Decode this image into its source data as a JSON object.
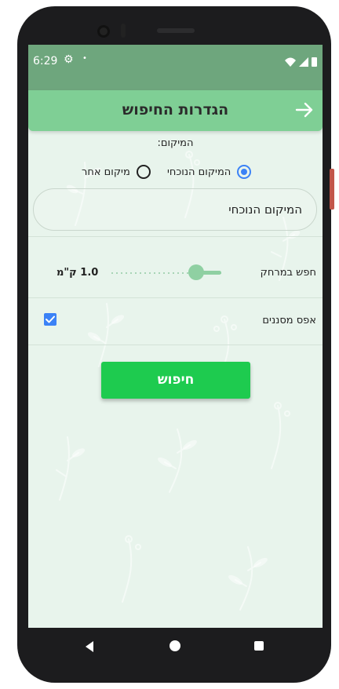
{
  "statusbar": {
    "time": "6:29",
    "dot": "•"
  },
  "appbar": {
    "title": "הגדרות החיפוש"
  },
  "form": {
    "location_label": "המיקום:",
    "radio_current_label": "המיקום הנוכחי",
    "radio_other_label": "מיקום אחר",
    "selected_radio": "current",
    "location_input_value": "המיקום הנוכחי",
    "distance_label": "חפש במרחק",
    "distance_value": "1.0 ק\"מ",
    "distance_fraction": 0.77,
    "reset_filters_label": "אפס מסננים",
    "reset_filters_checked": true,
    "search_button_label": "חיפוש"
  },
  "colors": {
    "statusbar": "#6ea67d",
    "appbar": "#7fcf95",
    "background": "#e8f4ec",
    "accent": "#3b82f6",
    "button": "#1ecb4f"
  },
  "icons": {
    "back": "arrow-right-icon",
    "settings": "gear-icon",
    "wifi": "wifi-icon",
    "signal": "signal-icon",
    "battery": "battery-icon"
  }
}
